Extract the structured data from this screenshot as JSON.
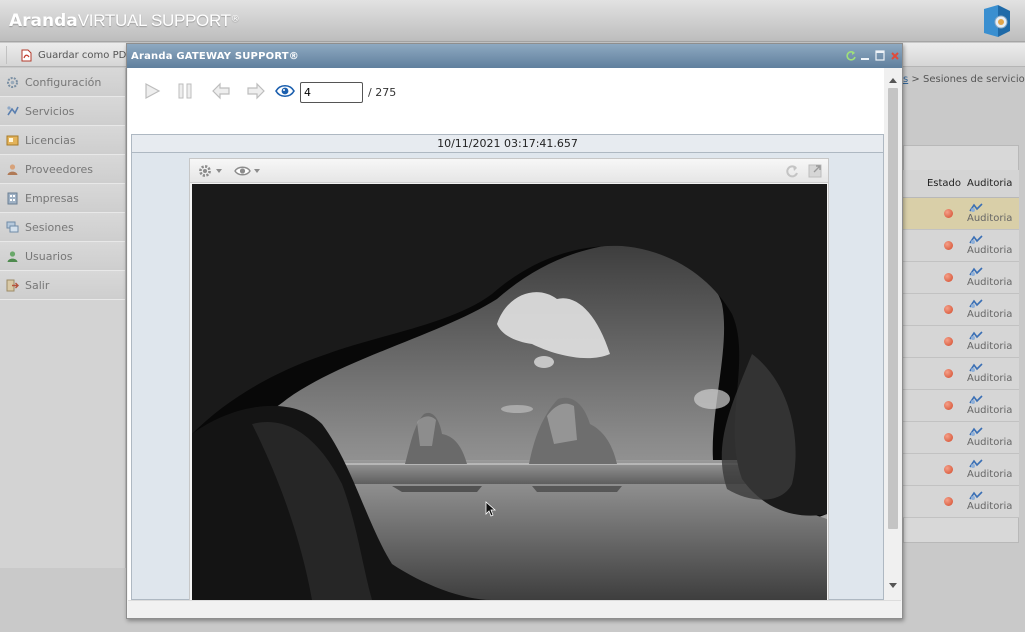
{
  "header": {
    "brand_strong": "Aranda",
    "brand_light": "VIRTUAL SUPPORT",
    "brand_mark": "®",
    "logo_icon": "aranda-logo-icon"
  },
  "toolbar": {
    "save_pdf_label": "Guardar como PDF",
    "save_pdf_icon": "pdf-icon"
  },
  "sidebar": {
    "items": [
      {
        "label": "Configuración",
        "icon": "gear-icon"
      },
      {
        "label": "Servicios",
        "icon": "services-icon"
      },
      {
        "label": "Licencias",
        "icon": "license-icon"
      },
      {
        "label": "Proveedores",
        "icon": "provider-icon"
      },
      {
        "label": "Empresas",
        "icon": "building-icon"
      },
      {
        "label": "Sesiones",
        "icon": "sessions-icon"
      },
      {
        "label": "Usuarios",
        "icon": "users-icon"
      },
      {
        "label": "Salir",
        "icon": "exit-icon"
      }
    ]
  },
  "background": {
    "breadcrumb_link": "s",
    "breadcrumb_sep": ">",
    "breadcrumb_current": "Sesiones de servicio",
    "table": {
      "headers": {
        "estado": "Estado",
        "auditoria": "Auditoria"
      },
      "row_label": "Auditoria",
      "row_count": 10,
      "selected_row": 0,
      "status_color": "#d24a2b"
    }
  },
  "dialog": {
    "title": "Aranda GATEWAY SUPPORT®",
    "controls": {
      "play_icon": "play-icon",
      "pause_icon": "pause-icon",
      "prev_icon": "arrow-left-icon",
      "next_icon": "arrow-right-icon",
      "view_icon": "eye-icon"
    },
    "frame_current": "4",
    "frame_total": "/ 275",
    "timestamp": "10/11/2021 03:17:41.657",
    "title_bar_color": "#6e8ead"
  }
}
